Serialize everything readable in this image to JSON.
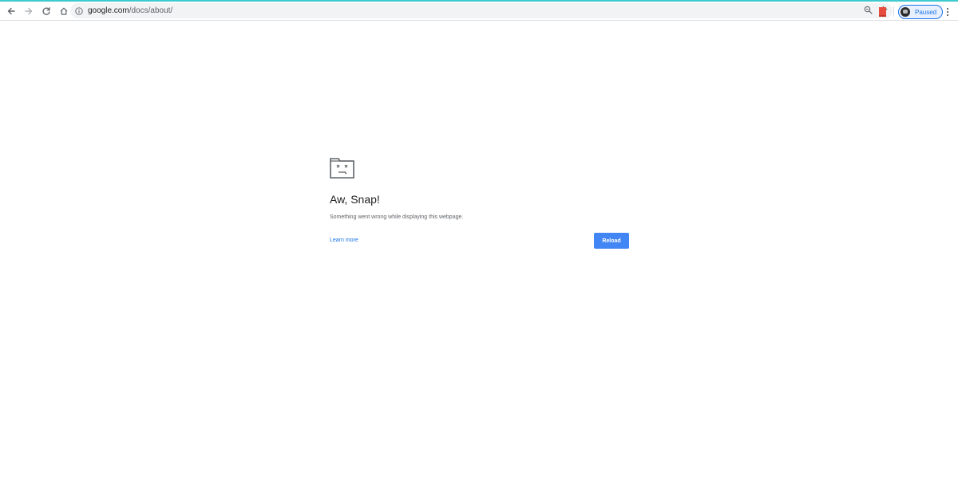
{
  "browser": {
    "address_bar": {
      "host": "google.com",
      "path": "/docs/about/"
    },
    "profile": {
      "status_label": "Paused"
    },
    "icons": {
      "back": "back-arrow-icon",
      "forward": "forward-arrow-icon",
      "reload": "reload-icon",
      "home": "home-icon",
      "site_info": "info-icon",
      "zoom": "zoom-icon",
      "bookmark": "star-icon",
      "extension": "extension-icon",
      "menu": "kebab-menu-icon"
    },
    "colors": {
      "loading_bar": "#3fcad0",
      "accent": "#1a73e8",
      "reload_button": "#4285f4"
    }
  },
  "error": {
    "icon": "sad-tab-icon",
    "title": "Aw, Snap!",
    "description": "Something went wrong while displaying this webpage.",
    "learn_more": "Learn more",
    "reload_label": "Reload"
  }
}
